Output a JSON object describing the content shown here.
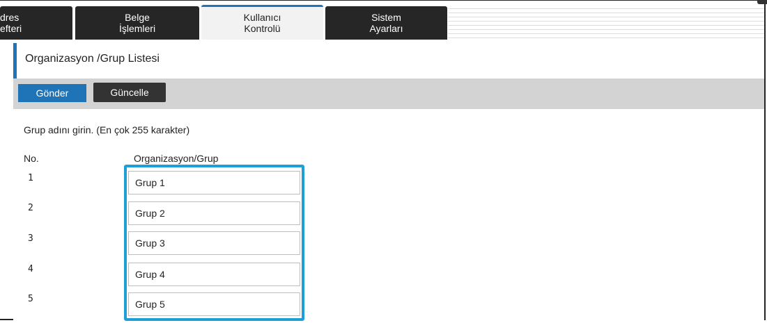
{
  "tabs": [
    {
      "line1": "dres",
      "line2": "efteri",
      "active": false
    },
    {
      "line1": "Belge",
      "line2": "İşlemleri",
      "active": false
    },
    {
      "line1": "Kullanıcı",
      "line2": "Kontrolü",
      "active": true
    },
    {
      "line1": "Sistem",
      "line2": "Ayarları",
      "active": false
    }
  ],
  "page": {
    "title": "Organizasyon /Grup Listesi"
  },
  "toolbar": {
    "send_label": "Gönder",
    "update_label": "Güncelle"
  },
  "form": {
    "hint": "Grup adını girin. (En çok 255 karakter)",
    "col_no": "No.",
    "col_group": "Organizasyon/Grup",
    "rows": [
      {
        "no": "1",
        "value": "Grup 1"
      },
      {
        "no": "2",
        "value": "Grup 2"
      },
      {
        "no": "3",
        "value": "Grup 3"
      },
      {
        "no": "4",
        "value": "Grup 4"
      },
      {
        "no": "5",
        "value": "Grup 5"
      }
    ]
  },
  "colors": {
    "accent": "#1f73b7",
    "highlight": "#1f9fd8",
    "tab_dark": "#262626",
    "toolbar_bg": "#d3d3d3"
  }
}
